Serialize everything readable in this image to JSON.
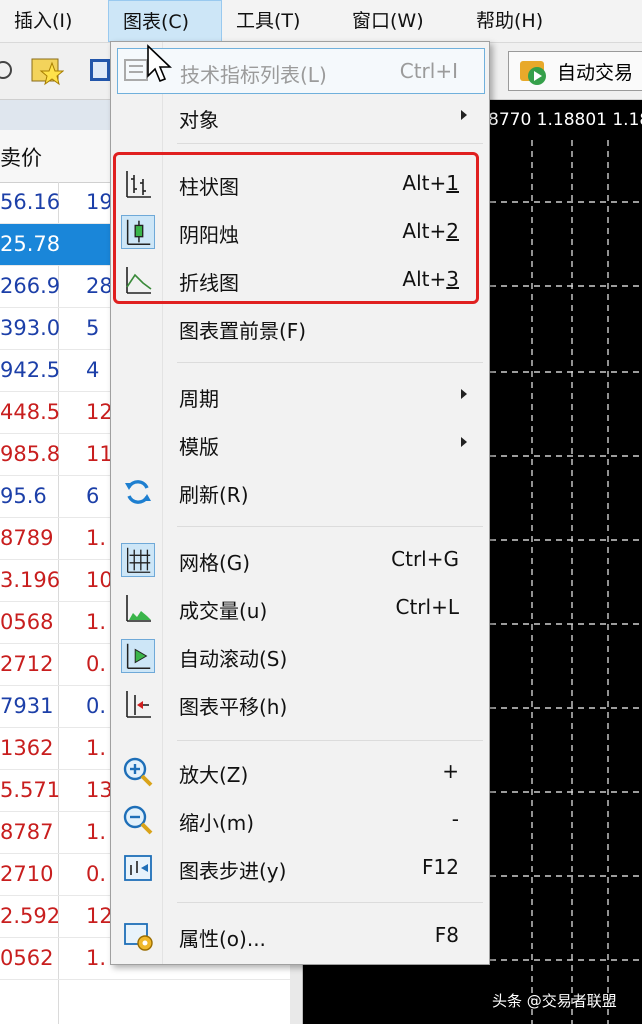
{
  "menubar": {
    "items": [
      {
        "label": "插入(I)"
      },
      {
        "label": "图表(C)"
      },
      {
        "label": "工具(T)"
      },
      {
        "label": "窗口(W)"
      },
      {
        "label": "帮助(H)"
      }
    ]
  },
  "toolbar": {
    "auto_trade_label": "自动交易"
  },
  "market_watch": {
    "column_header": "卖价",
    "rows": [
      {
        "bid": "56.16",
        "ask": "19",
        "color": "#1c3fa8"
      },
      {
        "bid": "25.78",
        "ask": "",
        "color": "#ffffff"
      },
      {
        "bid": "266.9",
        "ask": "28",
        "color": "#1c3fa8"
      },
      {
        "bid": "393.0",
        "ask": "5",
        "color": "#1c3fa8"
      },
      {
        "bid": "942.5",
        "ask": "4",
        "color": "#1c3fa8"
      },
      {
        "bid": "448.5",
        "ask": "12",
        "color": "#c81e1e"
      },
      {
        "bid": "985.8",
        "ask": "11",
        "color": "#c81e1e"
      },
      {
        "bid": "95.6",
        "ask": "6",
        "color": "#1c3fa8"
      },
      {
        "bid": "8789",
        "ask": "1.",
        "color": "#c81e1e"
      },
      {
        "bid": "3.196",
        "ask": "10",
        "color": "#c81e1e"
      },
      {
        "bid": "0568",
        "ask": "1.",
        "color": "#c81e1e"
      },
      {
        "bid": "2712",
        "ask": "0.",
        "color": "#c81e1e"
      },
      {
        "bid": "7931",
        "ask": "0.",
        "color": "#1c3fa8"
      },
      {
        "bid": "1362",
        "ask": "1.",
        "color": "#c81e1e"
      },
      {
        "bid": "5.571",
        "ask": "13",
        "color": "#c81e1e"
      },
      {
        "bid": "8787",
        "ask": "1.",
        "color": "#c81e1e"
      },
      {
        "bid": "2710",
        "ask": "0.",
        "color": "#c81e1e"
      },
      {
        "bid": "2.592",
        "ask": "12",
        "color": "#c81e1e"
      },
      {
        "bid": "0562",
        "ask": "1.",
        "color": "#c81e1e"
      }
    ]
  },
  "chart": {
    "quote_text": "8770 1.18801 1.18"
  },
  "menu": {
    "items": [
      {
        "label": "技术指标列表(L)",
        "shortcut": "Ctrl+I"
      },
      {
        "label": "对象"
      },
      {
        "label": "柱状图",
        "shortcut_prefix": "Alt+",
        "shortcut_key": "1"
      },
      {
        "label": "阴阳烛",
        "shortcut_prefix": "Alt+",
        "shortcut_key": "2"
      },
      {
        "label": "折线图",
        "shortcut_prefix": "Alt+",
        "shortcut_key": "3"
      },
      {
        "label": "图表置前景(F)"
      },
      {
        "label": "周期"
      },
      {
        "label": "模版"
      },
      {
        "label": "刷新(R)"
      },
      {
        "label": "网格(G)",
        "shortcut": "Ctrl+G"
      },
      {
        "label": "成交量(u)",
        "shortcut": "Ctrl+L"
      },
      {
        "label": "自动滚动(S)"
      },
      {
        "label": "图表平移(h)"
      },
      {
        "label": "放大(Z)",
        "shortcut": "+"
      },
      {
        "label": "缩小(m)",
        "shortcut": "-"
      },
      {
        "label": "图表步进(y)",
        "shortcut": "F12"
      },
      {
        "label": "属性(o)...",
        "shortcut": "F8"
      }
    ]
  },
  "watermark": "头条 @交易者联盟"
}
